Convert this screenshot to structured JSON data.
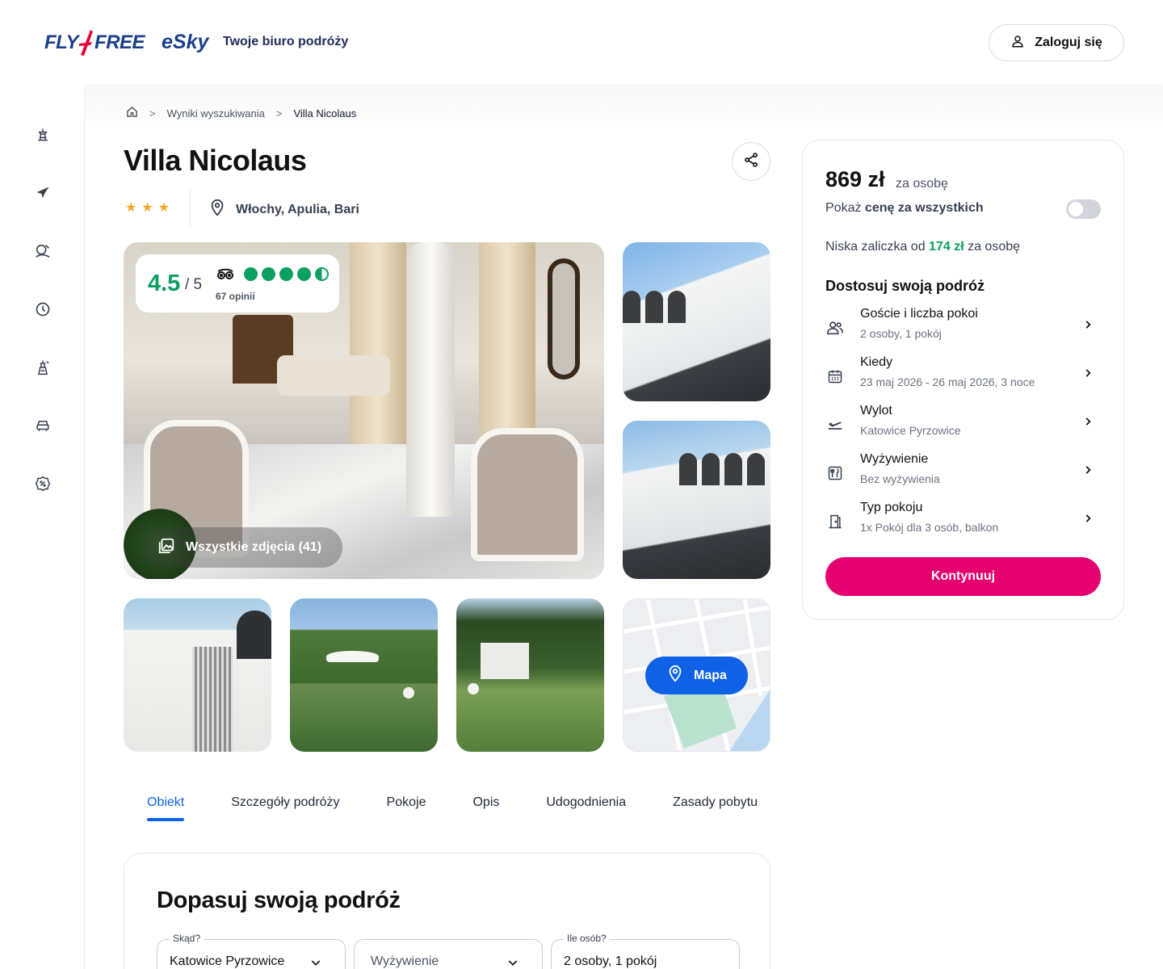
{
  "header": {
    "logo_fly_left": "FLY",
    "logo_fly_right": "FREE",
    "logo_esky": "eSky",
    "tagline": "Twoje biuro podróży",
    "login_label": "Zaloguj się"
  },
  "sidebar": {
    "items": [
      {
        "icon": "beach-holiday-icon"
      },
      {
        "icon": "plane-icon"
      },
      {
        "icon": "last-minute-sun-icon"
      },
      {
        "icon": "clock-icon"
      },
      {
        "icon": "city-break-icon"
      },
      {
        "icon": "car-icon"
      },
      {
        "icon": "promo-percent-icon"
      }
    ]
  },
  "breadcrumb": {
    "home_icon": "home-icon",
    "items": [
      "Wyniki wyszukiwania",
      "Villa Nicolaus"
    ],
    "separator": ">"
  },
  "hotel": {
    "name": "Villa Nicolaus",
    "stars": [
      "★",
      "★",
      "★"
    ],
    "location": "Włochy, Apulia, Bari"
  },
  "rating": {
    "score": "4.5",
    "out_of": "/ 5",
    "opinions": "67 opinii",
    "tripadvisor_bubbles": 4.5
  },
  "gallery": {
    "all_photos_label": "Wszystkie zdjęcia (41)",
    "map_label": "Mapa"
  },
  "tabs": [
    "Obiekt",
    "Szczegóły podróży",
    "Pokoje",
    "Opis",
    "Udogodnienia",
    "Zasady pobytu"
  ],
  "fit_section": {
    "title": "Dopasuj swoją podróż",
    "fields": [
      {
        "label": "Skąd?",
        "value": "Katowice Pyrzowice",
        "has_chevron": true
      },
      {
        "label": "",
        "value": "Wyżywienie",
        "placeholder": true,
        "has_chevron": true
      },
      {
        "label": "Ile osób?",
        "value": "2 osoby, 1 pokój",
        "has_chevron": false
      }
    ]
  },
  "price_panel": {
    "price": "869 zł",
    "per": "za osobę",
    "show_all_prefix": "Pokaż ",
    "show_all_bold": "cenę za wszystkich",
    "toggle_on": false,
    "deposit_prefix": "Niska zaliczka od ",
    "deposit_amount": "174 zł",
    "deposit_suffix": " za osobę",
    "adjust_title": "Dostosuj swoją podróż",
    "options": [
      {
        "icon": "guests-icon",
        "title": "Goście i liczba pokoi",
        "sub": "2 osoby, 1 pokój"
      },
      {
        "icon": "calendar-icon",
        "title": "Kiedy",
        "sub": "23 maj 2026 - 26 maj 2026, 3 noce"
      },
      {
        "icon": "departure-icon",
        "title": "Wylot",
        "sub": "Katowice Pyrzowice"
      },
      {
        "icon": "meal-icon",
        "title": "Wyżywienie",
        "sub": "Bez wyżywienia"
      },
      {
        "icon": "door-icon",
        "title": "Typ pokoju",
        "sub": "1x Pokój dla 3 osób, balkon"
      }
    ],
    "continue_label": "Kontynuuj"
  },
  "colors": {
    "brand_blue": "#0f62e6",
    "accent_pink": "#e4006f",
    "rating_green": "#0c9f62",
    "star": "#f5a623"
  }
}
